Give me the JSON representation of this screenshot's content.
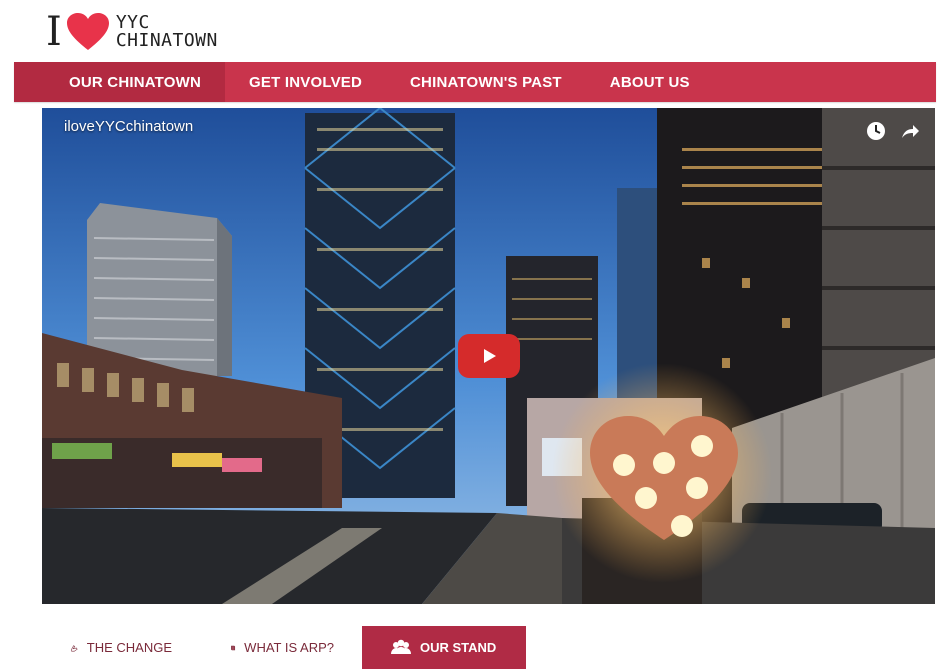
{
  "logo": {
    "i_letter": "I",
    "line1": "YYC",
    "line2": "CHINATOWN",
    "heart_color": "#e8334a"
  },
  "nav": {
    "items": [
      {
        "label": "OUR CHINATOWN",
        "active": true
      },
      {
        "label": "GET INVOLVED",
        "active": false
      },
      {
        "label": "CHINATOWN'S PAST",
        "active": false
      },
      {
        "label": "ABOUT US",
        "active": false
      }
    ],
    "color": "#c9344c"
  },
  "video": {
    "channel_title": "iloveYYCchinatown",
    "icons": [
      "clock-icon",
      "share-icon"
    ],
    "play_button_color": "#d52b2b"
  },
  "tabs": [
    {
      "label": "THE CHANGE",
      "icon": "hand-icon",
      "active": false
    },
    {
      "label": "WHAT IS ARP?",
      "icon": "book-icon",
      "active": false
    },
    {
      "label": "OUR STAND",
      "icon": "group-icon",
      "active": true
    }
  ]
}
